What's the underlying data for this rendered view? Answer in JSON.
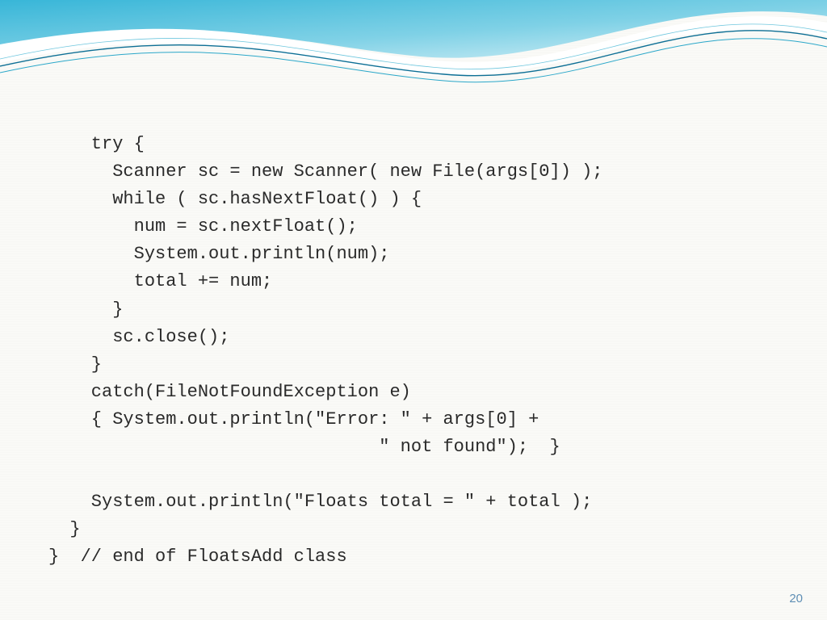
{
  "slide": {
    "page_number": "20",
    "code_lines": [
      "    try {",
      "      Scanner sc = new Scanner( new File(args[0]) );",
      "      while ( sc.hasNextFloat() ) {",
      "        num = sc.nextFloat();",
      "        System.out.println(num);",
      "        total += num;",
      "      }",
      "      sc.close();",
      "    }",
      "    catch(FileNotFoundException e)",
      "    { System.out.println(\"Error: \" + args[0] +",
      "                               \" not found\");  }",
      "",
      "    System.out.println(\"Floats total = \" + total );",
      "  }",
      "}  // end of FloatsAdd class"
    ]
  }
}
